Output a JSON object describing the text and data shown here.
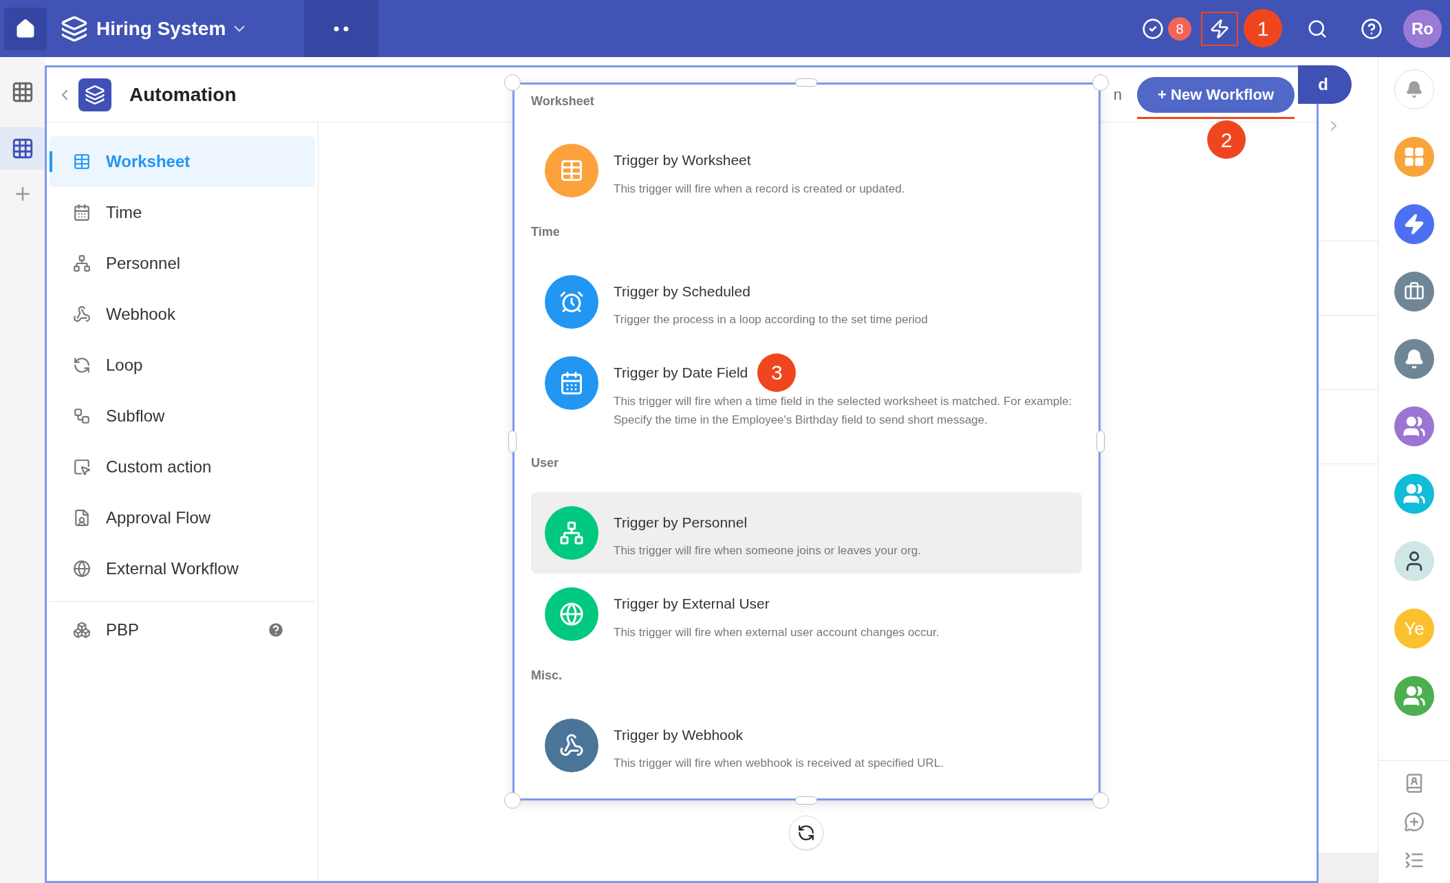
{
  "topbar": {
    "app_name": "Hiring System",
    "task_count": "8",
    "avatar_initials": "Ro",
    "marker": "1"
  },
  "left_rail": [
    {
      "kind": "grid",
      "selected": false
    },
    {
      "kind": "grid",
      "selected": true
    },
    {
      "kind": "add",
      "selected": false
    }
  ],
  "header": {
    "title": "Automation",
    "behind_text": "n",
    "behind_button_text": "d",
    "new_button": "+ New Workflow",
    "marker": "2"
  },
  "sidebar": {
    "items": [
      {
        "label": "Worksheet",
        "kind": "worksheet",
        "selected": true
      },
      {
        "label": "Time",
        "kind": "time",
        "selected": false
      },
      {
        "label": "Personnel",
        "kind": "personnel",
        "selected": false
      },
      {
        "label": "Webhook",
        "kind": "webhook",
        "selected": false
      },
      {
        "label": "Loop",
        "kind": "loop",
        "selected": false
      },
      {
        "label": "Subflow",
        "kind": "subflow",
        "selected": false
      },
      {
        "label": "Custom action",
        "kind": "custom",
        "selected": false
      },
      {
        "label": "Approval Flow",
        "kind": "approval",
        "selected": false
      },
      {
        "label": "External Workflow",
        "kind": "external",
        "selected": false
      }
    ],
    "footer": {
      "label": "PBP"
    }
  },
  "trigger_panel": {
    "sections": [
      {
        "title": "Worksheet",
        "items": [
          {
            "title": "Trigger by Worksheet",
            "description": "This trigger will fire when a record is created or updated.",
            "kind": "worksheet",
            "color": "#fba23c",
            "highlighted": false
          }
        ]
      },
      {
        "title": "Time",
        "items": [
          {
            "title": "Trigger by Scheduled",
            "description": "Trigger the process in a loop according to the set time period",
            "kind": "clock",
            "color": "#2196f3",
            "highlighted": false
          },
          {
            "title": "Trigger by Date Field",
            "description": "This trigger will fire when a time field in the selected worksheet is matched. For example: Specify the time in the Employee's Birthday field to send short message.",
            "kind": "calendar",
            "color": "#2196f3",
            "highlighted": false,
            "marker": "3"
          }
        ]
      },
      {
        "title": "User",
        "items": [
          {
            "title": "Trigger by Personnel",
            "description": "This trigger will fire when someone joins or leaves your org.",
            "kind": "personnel",
            "color": "#01c97f",
            "highlighted": true
          },
          {
            "title": "Trigger by External User",
            "description": "This trigger will fire when external user account changes occur.",
            "kind": "globe",
            "color": "#01c97f",
            "highlighted": false
          }
        ]
      },
      {
        "title": "Misc.",
        "items": [
          {
            "title": "Trigger by Webhook",
            "description": "This trigger will fire when webhook is received at specified URL.",
            "kind": "webhook",
            "color": "#4a7598",
            "highlighted": false
          }
        ]
      }
    ]
  },
  "right_rail": {
    "items": [
      {
        "kind": "bell-outline",
        "color": "#ffffff"
      },
      {
        "kind": "apps",
        "color": "#f9a33b"
      },
      {
        "kind": "bolt",
        "color": "#4d6ff2"
      },
      {
        "kind": "briefcase",
        "color": "#6f8696"
      },
      {
        "kind": "bell",
        "color": "#6f8696"
      },
      {
        "kind": "group",
        "color": "#9c74d3"
      },
      {
        "kind": "group",
        "color": "#10bcd6"
      },
      {
        "kind": "photo",
        "color": "#cfe6e4"
      },
      {
        "kind": "initials",
        "color": "#fbc02d",
        "text": "Ye"
      },
      {
        "kind": "group",
        "color": "#4caf50"
      }
    ],
    "tools": [
      {
        "kind": "contacts"
      },
      {
        "kind": "chat-add"
      },
      {
        "kind": "collapse"
      }
    ]
  }
}
